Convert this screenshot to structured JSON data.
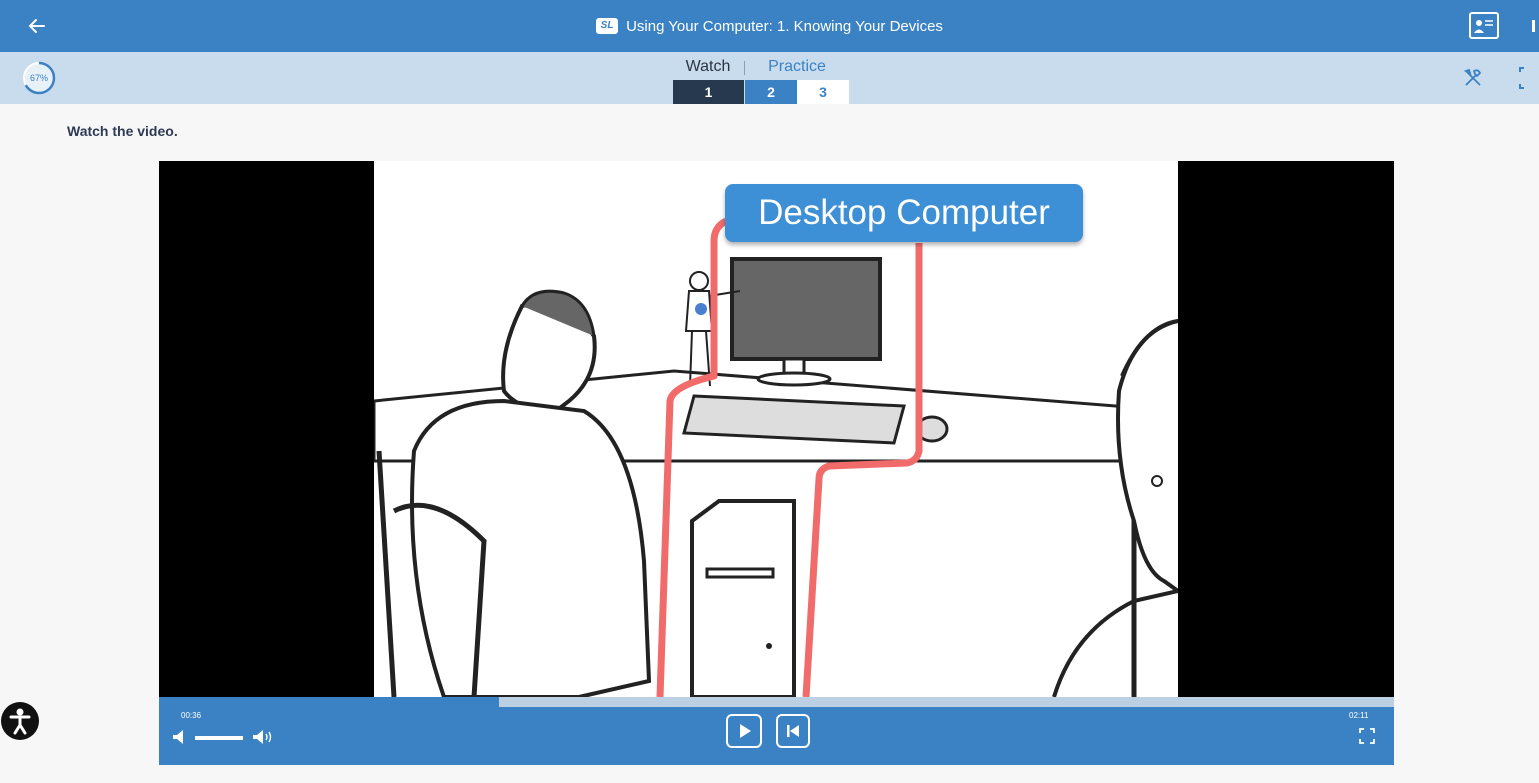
{
  "header": {
    "title": "Using Your Computer: 1. Knowing Your Devices",
    "logo_text": "SL",
    "back_icon": "arrow-left-icon",
    "slides_icon": "presentation-icon"
  },
  "subheader": {
    "progress_label": "67%",
    "progress_value": 0.67,
    "watch_label": "Watch",
    "practice_label": "Practice",
    "steps": [
      {
        "label": "1",
        "state": "current"
      },
      {
        "label": "2",
        "state": "available"
      },
      {
        "label": "3",
        "state": "available"
      }
    ],
    "tools_icon": "tools-icon",
    "expand_icon": "expand-icon"
  },
  "content": {
    "instruction": "Watch the video.",
    "video": {
      "callout_text": "Desktop Computer",
      "current_time": "00:36",
      "total_time": "02:11",
      "played_fraction": 0.275
    }
  },
  "colors": {
    "primary": "#3b82c4",
    "subbar": "#c9dcee",
    "current_step": "#27394f",
    "highlight_line": "#f26b6b"
  }
}
